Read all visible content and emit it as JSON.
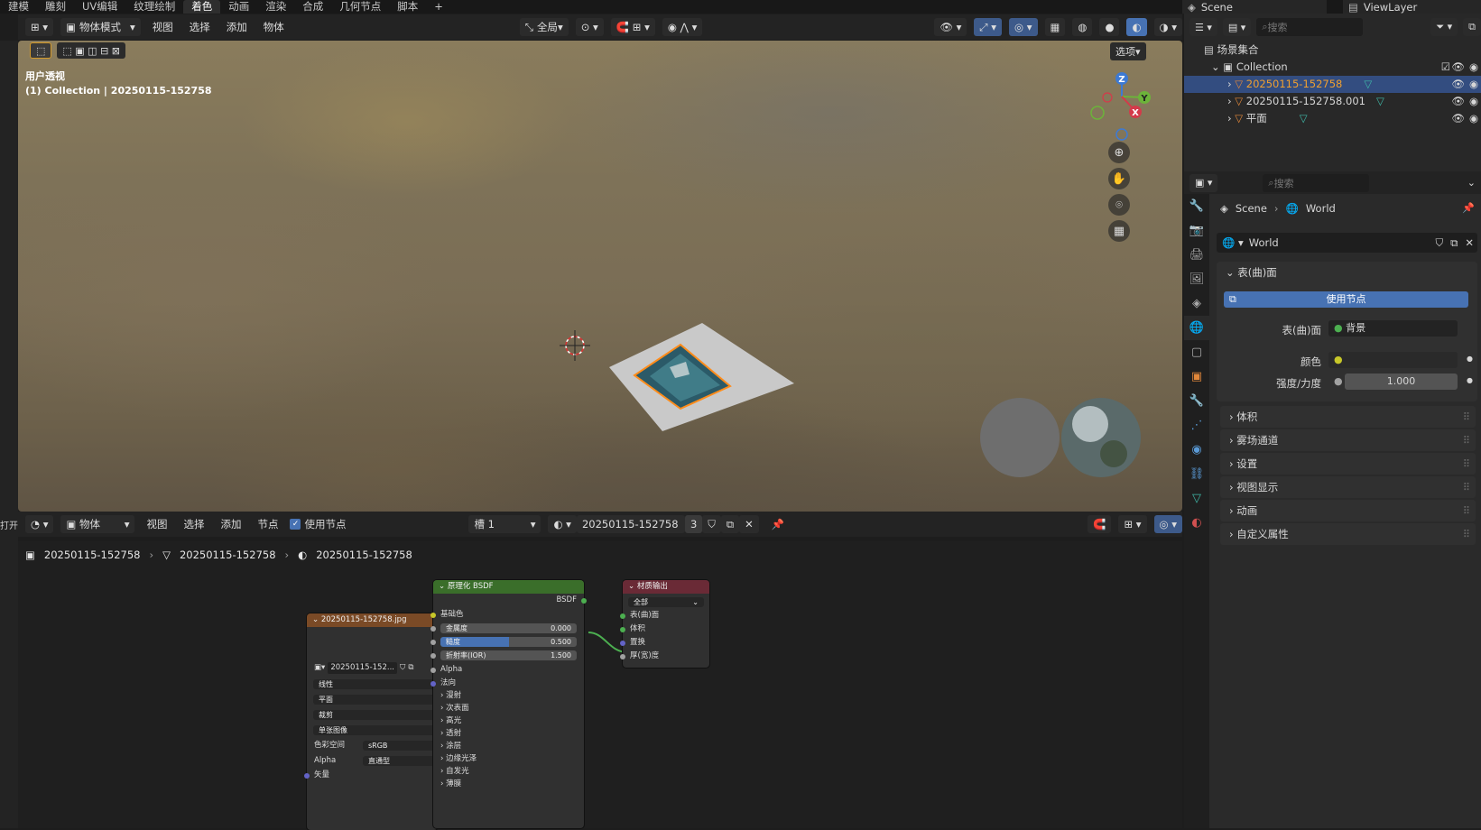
{
  "topbar": {
    "tabs": [
      "建模",
      "雕刻",
      "UV编辑",
      "纹理绘制",
      "着色",
      "动画",
      "渲染",
      "合成",
      "几何节点",
      "脚本",
      "+"
    ],
    "active_tab": "着色",
    "scene": "Scene",
    "view_layer": "ViewLayer"
  },
  "viewport_header": {
    "mode": "物体模式",
    "menus": [
      "视图",
      "选择",
      "添加",
      "物体"
    ],
    "transform_orientation": "全局",
    "options_label": "选项"
  },
  "viewport": {
    "view_name": "用户透视",
    "collection_line": "(1) Collection | 20250115-152758",
    "gizmo_axes": [
      "Z",
      "Y",
      "X"
    ]
  },
  "node_header": {
    "editor_type": "物体",
    "menus": [
      "视图",
      "选择",
      "添加",
      "节点"
    ],
    "use_nodes_label": "使用节点",
    "use_nodes_checked": true,
    "slot": "槽 1",
    "material_name": "20250115-152758",
    "user_count": "3",
    "left_stub": "打开"
  },
  "breadcrumb": [
    "20250115-152758",
    "20250115-152758",
    "20250115-152758"
  ],
  "image_node": {
    "title": "20250115-152758.jpg",
    "image_name": "20250115-152...",
    "interpolation": "线性",
    "projection": "平面",
    "extension": "裁剪",
    "source": "单张图像",
    "color_space_label": "色彩空间",
    "color_space": "sRGB",
    "alpha_label": "Alpha",
    "alpha_mode": "直通型",
    "vector": "矢量"
  },
  "bsdf_node": {
    "title": "原理化 BSDF",
    "output": "BSDF",
    "base_color": "基础色",
    "metallic_label": "金属度",
    "metallic": "0.000",
    "roughness_label": "糙度",
    "roughness": "0.500",
    "roughness_fraction": 0.5,
    "ior_label": "折射率(IOR)",
    "ior": "1.500",
    "alpha": "Alpha",
    "normal": "法向",
    "subpanels": [
      "漫射",
      "次表面",
      "高光",
      "透射",
      "涂层",
      "边缘光泽",
      "自发光",
      "薄膜"
    ]
  },
  "output_node": {
    "title": "材质输出",
    "target": "全部",
    "inputs": [
      "表(曲)面",
      "体积",
      "置换",
      "厚(宽)度"
    ]
  },
  "outliner": {
    "search_placeholder": "搜索",
    "scene_collection": "场景集合",
    "collection": "Collection",
    "items": [
      "20250115-152758",
      "20250115-152758.001",
      "平面"
    ]
  },
  "properties": {
    "search_placeholder": "搜索",
    "breadcrumb_scene": "Scene",
    "breadcrumb_world": "World",
    "world_name": "World",
    "surface_panel": "表(曲)面",
    "use_nodes_button": "使用节点",
    "surface_label": "表(曲)面",
    "surface_value": "背景",
    "color_label": "颜色",
    "strength_label": "强度/力度",
    "strength_value": "1.000",
    "panels": [
      "体积",
      "雾场通道",
      "设置",
      "视图显示",
      "动画",
      "自定义属性"
    ]
  },
  "colors": {
    "accent_blue": "#4772b3",
    "selected_row": "#334d80",
    "image_node_header": "#7a4a26",
    "bsdf_header": "#3a6e2a",
    "output_header": "#6a2a36",
    "selection_orange": "#ff8c1a"
  }
}
